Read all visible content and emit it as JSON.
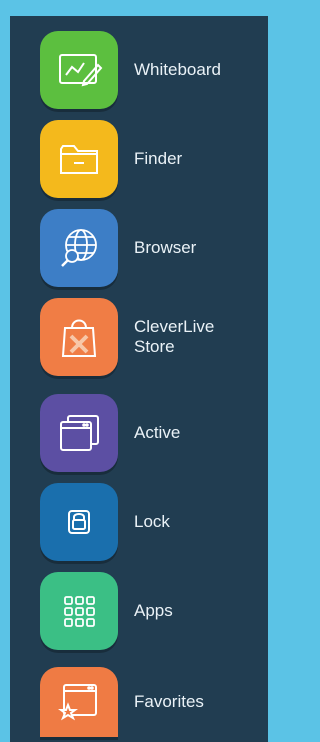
{
  "menu": {
    "items": [
      {
        "label": "Whiteboard",
        "icon": "whiteboard-icon",
        "color": "#5cbf3f"
      },
      {
        "label": "Finder",
        "icon": "folder-icon",
        "color": "#f4b91c"
      },
      {
        "label": "Browser",
        "icon": "globe-search-icon",
        "color": "#3d7ec6"
      },
      {
        "label": "CleverLive\nStore",
        "icon": "shopping-bag-icon",
        "color": "#f07d45"
      },
      {
        "label": "Active",
        "icon": "windows-icon",
        "color": "#5c4fa3"
      },
      {
        "label": "Lock",
        "icon": "lock-icon",
        "color": "#1a6fad"
      },
      {
        "label": "Apps",
        "icon": "apps-grid-icon",
        "color": "#3bbf85"
      },
      {
        "label": "Favorites",
        "icon": "favorites-window-icon",
        "color": "#ef7b44"
      }
    ]
  }
}
